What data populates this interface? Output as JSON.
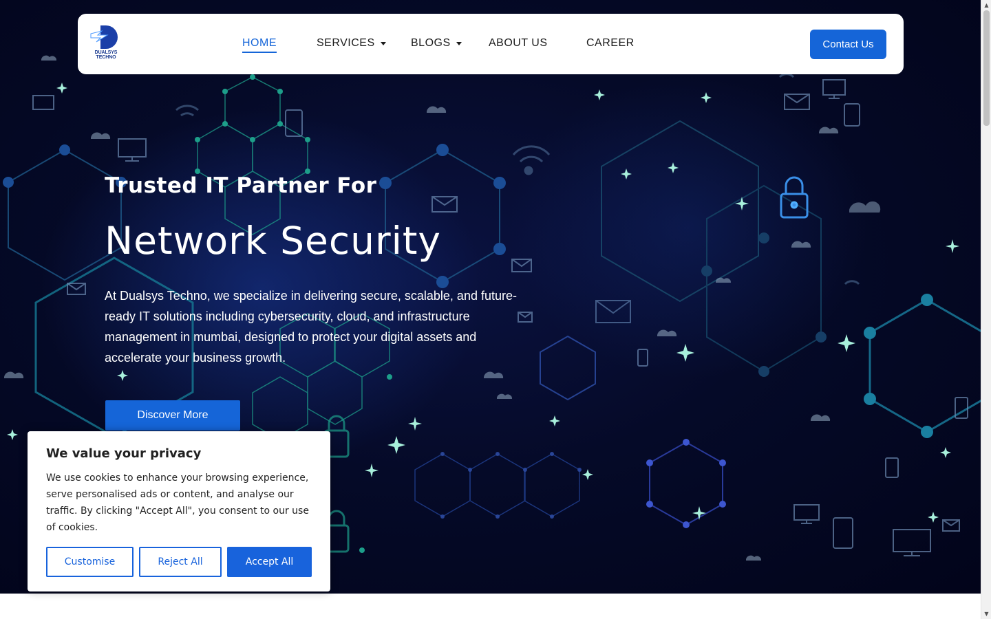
{
  "brand": {
    "logo_text": "DUALSYS TECHNO"
  },
  "nav": {
    "items": [
      {
        "label": "HOME",
        "active": true,
        "dropdown": false
      },
      {
        "label": "SERVICES",
        "active": false,
        "dropdown": true
      },
      {
        "label": "BLOGS",
        "active": false,
        "dropdown": true
      },
      {
        "label": "ABOUT US",
        "active": false,
        "dropdown": false
      },
      {
        "label": "CAREER",
        "active": false,
        "dropdown": false
      }
    ],
    "cta_label": "Contact Us"
  },
  "hero": {
    "subtitle": "Trusted IT Partner For",
    "title": "Network Security",
    "description": "At Dualsys Techno, we specialize in delivering secure, scalable, and future-ready IT solutions including cybersecurity, cloud, and infrastructure management in mumbai, designed to protect your digital assets and accelerate your business growth.",
    "button_label": "Discover More"
  },
  "cookie_banner": {
    "title": "We value your privacy",
    "text": "We use cookies to enhance your browsing experience, serve personalised ads or content, and analyse our traffic. By clicking \"Accept All\", you consent to our use of cookies.",
    "customise_label": "Customise",
    "reject_label": "Reject All",
    "accept_label": "Accept All"
  },
  "colors": {
    "accent": "#1565d8",
    "hero_bg": "#02041a",
    "network_lines": "#1a6fa0"
  }
}
